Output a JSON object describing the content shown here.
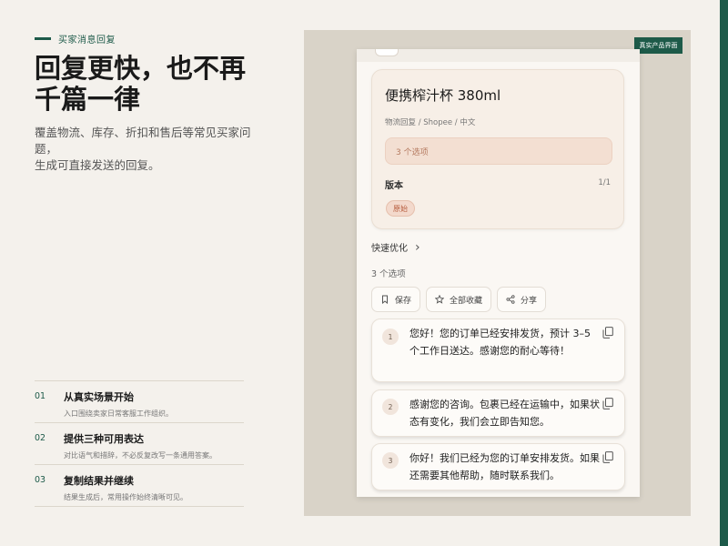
{
  "eyebrow": "买家消息回复",
  "headline": {
    "line1": "回复更快，也不再",
    "line2": "千篇一律"
  },
  "description": {
    "line1": "覆盖物流、库存、折扣和售后等常见买家问题，",
    "line2": "生成可直接发送的回复。"
  },
  "features": [
    {
      "num": "01",
      "title": "从真实场景开始",
      "subtitle": "入口围绕卖家日常客服工作组织。"
    },
    {
      "num": "02",
      "title": "提供三种可用表达",
      "subtitle": "对比语气和措辞，不必反复改写一条通用答案。"
    },
    {
      "num": "03",
      "title": "复制结果并继续",
      "subtitle": "结果生成后，常用操作始终清晰可见。"
    }
  ],
  "badge": "真实产品界面",
  "app": {
    "product_title": "便携榨汁杯 380ml",
    "product_meta": "物流回复 / Shopee / 中文",
    "options_pill": "3 个选项",
    "version_label": "版本",
    "version_count": "1/1",
    "original_tag": "原始",
    "quick_optimize": "快速优化",
    "chevron": "›",
    "count_label": "3 个选项",
    "actions": {
      "save": "保存",
      "favorite_all": "全部收藏",
      "share": "分享"
    },
    "replies": [
      {
        "num": "1",
        "text": "您好！您的订单已经安排发货，预计 3–5 个工作日送达。感谢您的耐心等待！"
      },
      {
        "num": "2",
        "text": "感谢您的咨询。包裹已经在运输中，如果状态有变化，我们会立即告知您。"
      },
      {
        "num": "3",
        "text": "你好！我们已经为您的订单安排发货。如果还需要其他帮助，随时联系我们。"
      }
    ]
  },
  "colors": {
    "accent": "#1d5a49",
    "background": "#f4f1ec",
    "panel": "#d9d3c8",
    "tag": "#b75d3e"
  },
  "icons": [
    "bookmark-icon",
    "star-icon",
    "share-icon",
    "copy-icon",
    "chevron-right-icon"
  ]
}
